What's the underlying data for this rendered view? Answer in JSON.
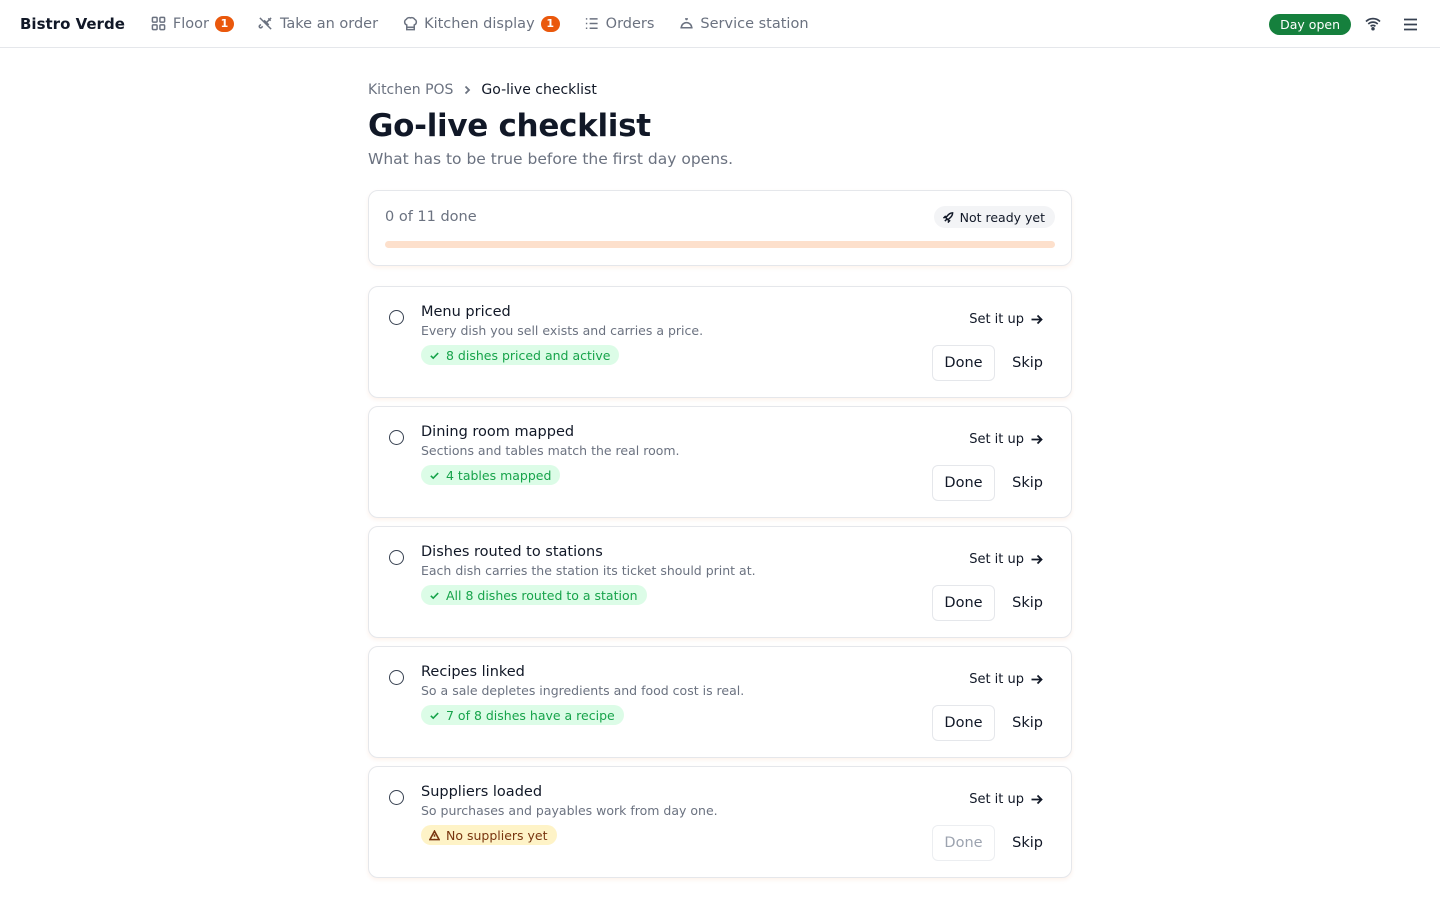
{
  "app": {
    "brand": "Bistro Verde"
  },
  "nav": [
    {
      "label": "Floor",
      "icon": "grid-icon",
      "badge": "1"
    },
    {
      "label": "Take an order",
      "icon": "utensils-icon",
      "badge": ""
    },
    {
      "label": "Kitchen display",
      "icon": "chef-hat-icon",
      "badge": "1"
    },
    {
      "label": "Orders",
      "icon": "list-icon",
      "badge": ""
    },
    {
      "label": "Service station",
      "icon": "cloche-icon",
      "badge": ""
    }
  ],
  "topbar": {
    "day_status": "Day open",
    "wifi_icon": "wifi-icon",
    "menu_icon": "hamburger-icon"
  },
  "breadcrumb": {
    "parent": "Kitchen POS",
    "current": "Go-live checklist"
  },
  "page": {
    "title": "Go-live checklist",
    "subtitle": "What has to be true before the first day opens."
  },
  "progress": {
    "text": "0 of 11 done",
    "done": 0,
    "total": 11,
    "status": "Not ready yet",
    "status_icon": "rocket-icon",
    "bar_color": "#ea580c",
    "track_color": "#fde0cc"
  },
  "checklist": [
    {
      "title": "Menu priced",
      "description": "Every dish you sell exists and carries a price.",
      "badge": "8 dishes priced and active",
      "badge_type": "ok",
      "setup_label": "Set it up",
      "done_label": "Done",
      "skip_label": "Skip",
      "done_enabled": true
    },
    {
      "title": "Dining room mapped",
      "description": "Sections and tables match the real room.",
      "badge": "4 tables mapped",
      "badge_type": "ok",
      "setup_label": "Set it up",
      "done_label": "Done",
      "skip_label": "Skip",
      "done_enabled": true
    },
    {
      "title": "Dishes routed to stations",
      "description": "Each dish carries the station its ticket should print at.",
      "badge": "All 8 dishes routed to a station",
      "badge_type": "ok",
      "setup_label": "Set it up",
      "done_label": "Done",
      "skip_label": "Skip",
      "done_enabled": true
    },
    {
      "title": "Recipes linked",
      "description": "So a sale depletes ingredients and food cost is real.",
      "badge": "7 of 8 dishes have a recipe",
      "badge_type": "ok",
      "setup_label": "Set it up",
      "done_label": "Done",
      "skip_label": "Skip",
      "done_enabled": true
    },
    {
      "title": "Suppliers loaded",
      "description": "So purchases and payables work from day one.",
      "badge": "No suppliers yet",
      "badge_type": "warn",
      "setup_label": "Set it up",
      "done_label": "Done",
      "skip_label": "Skip",
      "done_enabled": false
    }
  ],
  "colors": {
    "accent": "#ea580c",
    "success": "#15803d",
    "success_badge_text": "#16a34a",
    "warn_badge_bg": "#fef3c7"
  }
}
